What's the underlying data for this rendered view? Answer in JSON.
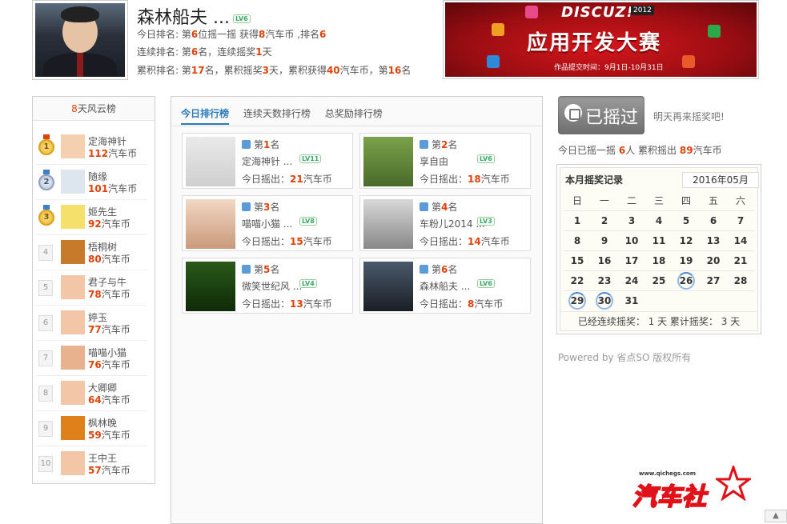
{
  "profile": {
    "name": "森林船夫 ...",
    "level": "LV6",
    "today_rank": {
      "prefix": "今日排名: 第",
      "rank": "6",
      "mid1": "位摇一摇 获得",
      "coins": "8",
      "mid2": "汽车币 ,排名",
      "pos": "6"
    },
    "streak_rank": {
      "prefix": "连续排名: 第",
      "rank": "6",
      "mid1": "名，连续摇奖",
      "days": "1",
      "suffix": "天"
    },
    "total_rank": {
      "prefix": "累积排名: 第",
      "rank": "17",
      "mid1": "名，累积摇奖",
      "days": "3",
      "mid2": "天，累积获得",
      "coins": "40",
      "mid3": "汽车币，第",
      "pos": "16",
      "suffix": "名"
    }
  },
  "banner": {
    "brand": "DISCUZ!",
    "year": "2012",
    "title": "应用开发大赛",
    "subtitle": "作品提交时间：9月1日-10月31日"
  },
  "week_board": {
    "title_num": "8",
    "title_text": "天风云榜",
    "items": [
      {
        "rank": "1",
        "name": "定海神针",
        "coins": "112",
        "unit": "汽车币"
      },
      {
        "rank": "2",
        "name": "随缘",
        "coins": "101",
        "unit": "汽车币"
      },
      {
        "rank": "3",
        "name": "姬先生",
        "coins": "92",
        "unit": "汽车币"
      },
      {
        "rank": "4",
        "name": "梧桐树",
        "coins": "80",
        "unit": "汽车币"
      },
      {
        "rank": "5",
        "name": "君子与牛",
        "coins": "78",
        "unit": "汽车币"
      },
      {
        "rank": "6",
        "name": "婷玉",
        "coins": "77",
        "unit": "汽车币"
      },
      {
        "rank": "7",
        "name": "喵喵小猫",
        "coins": "76",
        "unit": "汽车币"
      },
      {
        "rank": "8",
        "name": "大卿卿",
        "coins": "64",
        "unit": "汽车币"
      },
      {
        "rank": "9",
        "name": "枫林晚",
        "coins": "59",
        "unit": "汽车币"
      },
      {
        "rank": "10",
        "name": "王中王",
        "coins": "57",
        "unit": "汽车币"
      }
    ]
  },
  "tabs": [
    "今日排行榜",
    "连续天数排行榜",
    "总奖励排行榜"
  ],
  "cards": [
    {
      "rank_prefix": "第",
      "rank": "1",
      "rank_suffix": "名",
      "name": "定海神针 ...",
      "level": "LV11",
      "today_label": "今日摇出：",
      "coins": "21",
      "unit": "汽车币"
    },
    {
      "rank_prefix": "第",
      "rank": "2",
      "rank_suffix": "名",
      "name": "享自由",
      "level": "LV6",
      "today_label": "今日摇出：",
      "coins": "18",
      "unit": "汽车币"
    },
    {
      "rank_prefix": "第",
      "rank": "3",
      "rank_suffix": "名",
      "name": "喵喵小猫 ...",
      "level": "LV8",
      "today_label": "今日摇出：",
      "coins": "15",
      "unit": "汽车币"
    },
    {
      "rank_prefix": "第",
      "rank": "4",
      "rank_suffix": "名",
      "name": "车粉儿2014 ...",
      "level": "LV3",
      "today_label": "今日摇出：",
      "coins": "14",
      "unit": "汽车币"
    },
    {
      "rank_prefix": "第",
      "rank": "5",
      "rank_suffix": "名",
      "name": "微笑世纪风 ...",
      "level": "LV4",
      "today_label": "今日摇出：",
      "coins": "13",
      "unit": "汽车币"
    },
    {
      "rank_prefix": "第",
      "rank": "6",
      "rank_suffix": "名",
      "name": "森林船夫 ...",
      "level": "LV6",
      "today_label": "今日摇出：",
      "coins": "8",
      "unit": "汽车币"
    }
  ],
  "shake": {
    "button_label": "已摇过",
    "hint": "明天再来摇奖吧!"
  },
  "today_summary": {
    "prefix": "今日已摇一摇",
    "people": "6",
    "mid": "人 累积摇出",
    "coins": "89",
    "unit": "汽车币"
  },
  "calendar": {
    "title": "本月摇奖记录",
    "month": "2016年05月",
    "weekdays": [
      "日",
      "一",
      "二",
      "三",
      "四",
      "五",
      "六"
    ],
    "weeks": [
      [
        "1",
        "2",
        "3",
        "4",
        "5",
        "6",
        "7"
      ],
      [
        "8",
        "9",
        "10",
        "11",
        "12",
        "13",
        "14"
      ],
      [
        "15",
        "16",
        "17",
        "18",
        "19",
        "20",
        "21"
      ],
      [
        "22",
        "23",
        "24",
        "25",
        "26",
        "27",
        "28"
      ],
      [
        "29",
        "30",
        "31",
        "",
        "",
        "",
        ""
      ]
    ],
    "marked": [
      "26",
      "29",
      "30"
    ],
    "footer": "已经连续摇奖： 1 天  累计摇奖： 3 天"
  },
  "powered": "Powered by 省点SO 版权所有",
  "watermark": {
    "url": "www.qichegs.com",
    "text": "汽车社"
  },
  "colors": {
    "accent": "#e0420a",
    "link": "#2a7ab9",
    "banner": "#c8141a"
  }
}
